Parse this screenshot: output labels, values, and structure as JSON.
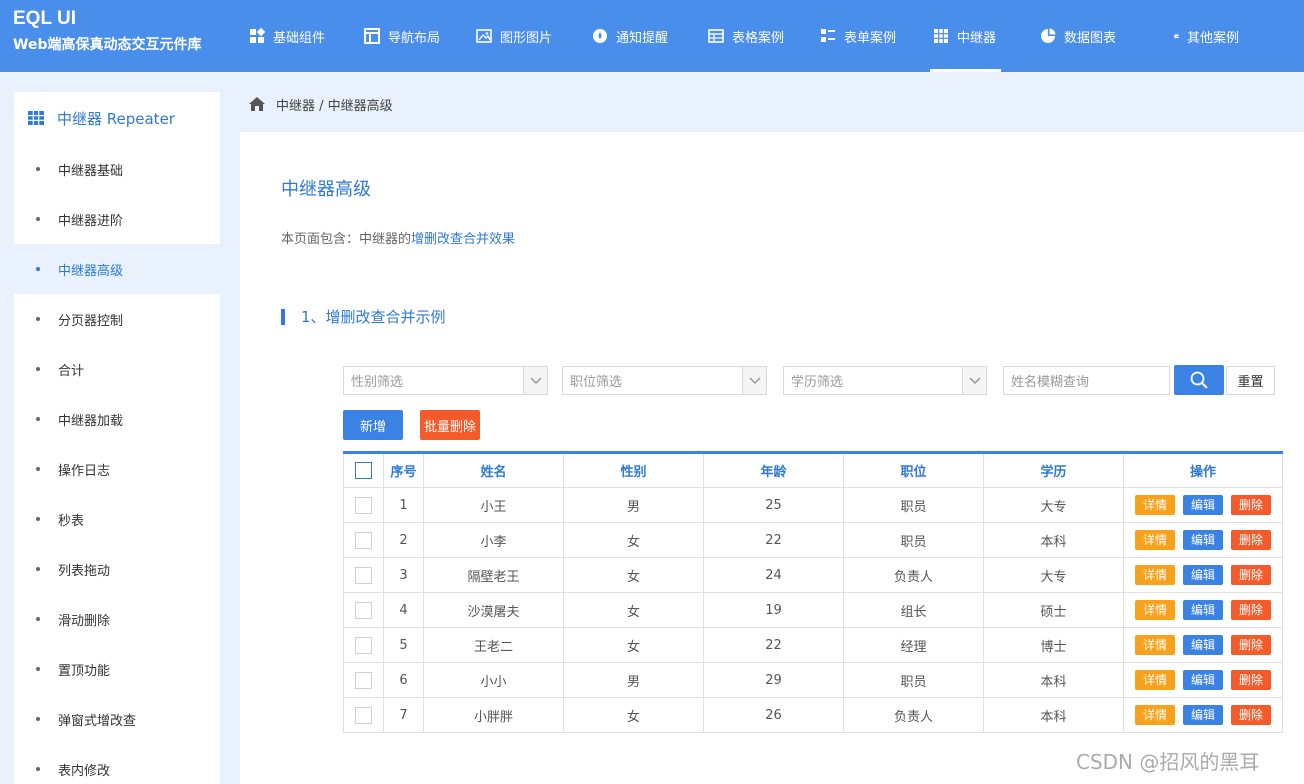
{
  "brand": {
    "title": "EQL UI",
    "subtitle": "Web端高保真动态交互元件库"
  },
  "nav": [
    {
      "label": "基础组件",
      "icon": "components-icon"
    },
    {
      "label": "导航布局",
      "icon": "layout-icon"
    },
    {
      "label": "图形图片",
      "icon": "image-icon"
    },
    {
      "label": "通知提醒",
      "icon": "notification-icon"
    },
    {
      "label": "表格案例",
      "icon": "table-icon"
    },
    {
      "label": "表单案例",
      "icon": "form-icon"
    },
    {
      "label": "中继器",
      "icon": "grid-icon",
      "active": true
    },
    {
      "label": "数据图表",
      "icon": "pie-chart-icon"
    },
    {
      "label": "其他案例",
      "icon": "wallet-icon"
    }
  ],
  "sidebar": {
    "header": "中继器 Repeater",
    "items": [
      {
        "label": "中继器基础"
      },
      {
        "label": "中继器进阶"
      },
      {
        "label": "中继器高级",
        "active": true
      },
      {
        "label": "分页器控制"
      },
      {
        "label": "合计"
      },
      {
        "label": "中继器加载"
      },
      {
        "label": "操作日志"
      },
      {
        "label": "秒表"
      },
      {
        "label": "列表拖动"
      },
      {
        "label": "滑动删除"
      },
      {
        "label": "置顶功能"
      },
      {
        "label": "弹窗式增改查"
      },
      {
        "label": "表内修改"
      }
    ]
  },
  "breadcrumb": "中继器 / 中继器高级",
  "main": {
    "title": "中继器高级",
    "desc_prefix": "本页面包含：中继器的",
    "desc_highlight": "增删改查合并效果",
    "section_title": "1、增删改查合并示例"
  },
  "filters": {
    "gender_placeholder": "性别筛选",
    "position_placeholder": "职位筛选",
    "education_placeholder": "学历筛选",
    "name_placeholder": "姓名模糊查询",
    "reset_label": "重置"
  },
  "buttons": {
    "add": "新增",
    "batch_delete": "批量删除"
  },
  "table": {
    "headers": [
      "序号",
      "姓名",
      "性别",
      "年龄",
      "职位",
      "学历",
      "操作"
    ],
    "action_labels": {
      "detail": "详情",
      "edit": "编辑",
      "delete": "删除"
    },
    "rows": [
      [
        "1",
        "小王",
        "男",
        "25",
        "职员",
        "大专"
      ],
      [
        "2",
        "小李",
        "女",
        "22",
        "职员",
        "本科"
      ],
      [
        "3",
        "隔壁老王",
        "女",
        "24",
        "负责人",
        "大专"
      ],
      [
        "4",
        "沙漠屠夫",
        "女",
        "19",
        "组长",
        "硕士"
      ],
      [
        "5",
        "王老二",
        "女",
        "22",
        "经理",
        "博士"
      ],
      [
        "6",
        "小小",
        "男",
        "29",
        "职员",
        "本科"
      ],
      [
        "7",
        "小胖胖",
        "女",
        "26",
        "负责人",
        "本科"
      ]
    ]
  },
  "watermark": "CSDN @招风的黑耳",
  "colors": {
    "topbar": "#4a8eeb",
    "accent": "#2e7ad6",
    "danger": "#f45a2a",
    "warning": "#f7a21a"
  }
}
